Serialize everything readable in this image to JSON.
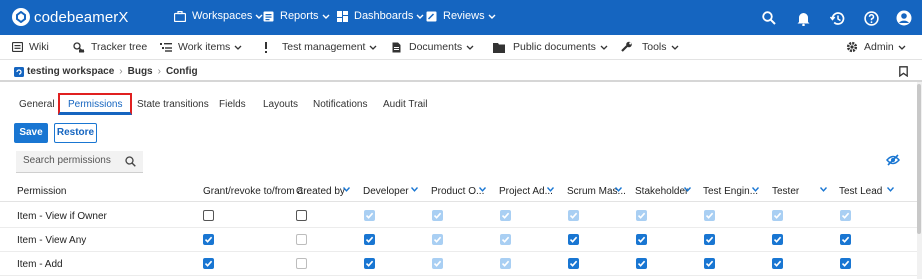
{
  "app": {
    "name": "codebeamerX"
  },
  "topnav": [
    {
      "label": "Workspaces",
      "icon": "workspaces-icon"
    },
    {
      "label": "Reports",
      "icon": "reports-icon"
    },
    {
      "label": "Dashboards",
      "icon": "dashboards-icon"
    },
    {
      "label": "Reviews",
      "icon": "reviews-icon"
    }
  ],
  "menubar": [
    {
      "label": "Wiki",
      "icon": "wiki-icon",
      "dropdown": false
    },
    {
      "label": "Tracker tree",
      "icon": "tracker-tree-icon",
      "dropdown": false
    },
    {
      "label": "Work items",
      "icon": "work-items-icon",
      "dropdown": true
    },
    {
      "label": "Test management",
      "icon": "test-management-icon",
      "dropdown": true
    },
    {
      "label": "Documents",
      "icon": "documents-icon",
      "dropdown": true
    },
    {
      "label": "Public documents",
      "icon": "public-documents-icon",
      "dropdown": true
    },
    {
      "label": "Tools",
      "icon": "tools-icon",
      "dropdown": true
    },
    {
      "label": "Admin",
      "icon": "admin-gear-icon",
      "dropdown": true
    }
  ],
  "breadcrumb": [
    "testing workspace",
    "Bugs",
    "Config"
  ],
  "tabs": [
    {
      "label": "General",
      "active": false
    },
    {
      "label": "Permissions",
      "active": true
    },
    {
      "label": "State transitions",
      "active": false
    },
    {
      "label": "Fields",
      "active": false
    },
    {
      "label": "Layouts",
      "active": false
    },
    {
      "label": "Notifications",
      "active": false
    },
    {
      "label": "Audit Trail",
      "active": false
    }
  ],
  "buttons": {
    "save": "Save",
    "restore": "Restore"
  },
  "search": {
    "placeholder": "Search permissions",
    "value": ""
  },
  "table": {
    "columns": [
      "Permission",
      "Grant/revoke to/from a",
      "Created by",
      "Developer",
      "Product O...",
      "Project Ad...",
      "Scrum Mas...",
      "Stakeholder",
      "Test Engin...",
      "Tester",
      "Test Lead"
    ],
    "rows": [
      {
        "label": "Item - View if Owner",
        "cells": [
          "off",
          "off",
          "dis",
          "dis",
          "dis",
          "dis",
          "dis",
          "dis",
          "dis",
          "dis"
        ]
      },
      {
        "label": "Item - View Any",
        "cells": [
          "on",
          "offdis",
          "on",
          "dis",
          "dis",
          "on",
          "on",
          "on",
          "on",
          "on"
        ]
      },
      {
        "label": "Item - Add",
        "cells": [
          "on",
          "offdis",
          "on",
          "dis",
          "dis",
          "on",
          "on",
          "on",
          "on",
          "on"
        ]
      }
    ]
  },
  "colors": {
    "brand": "#1565c0",
    "accent": "#1976d2",
    "highlight": "#e02020"
  }
}
